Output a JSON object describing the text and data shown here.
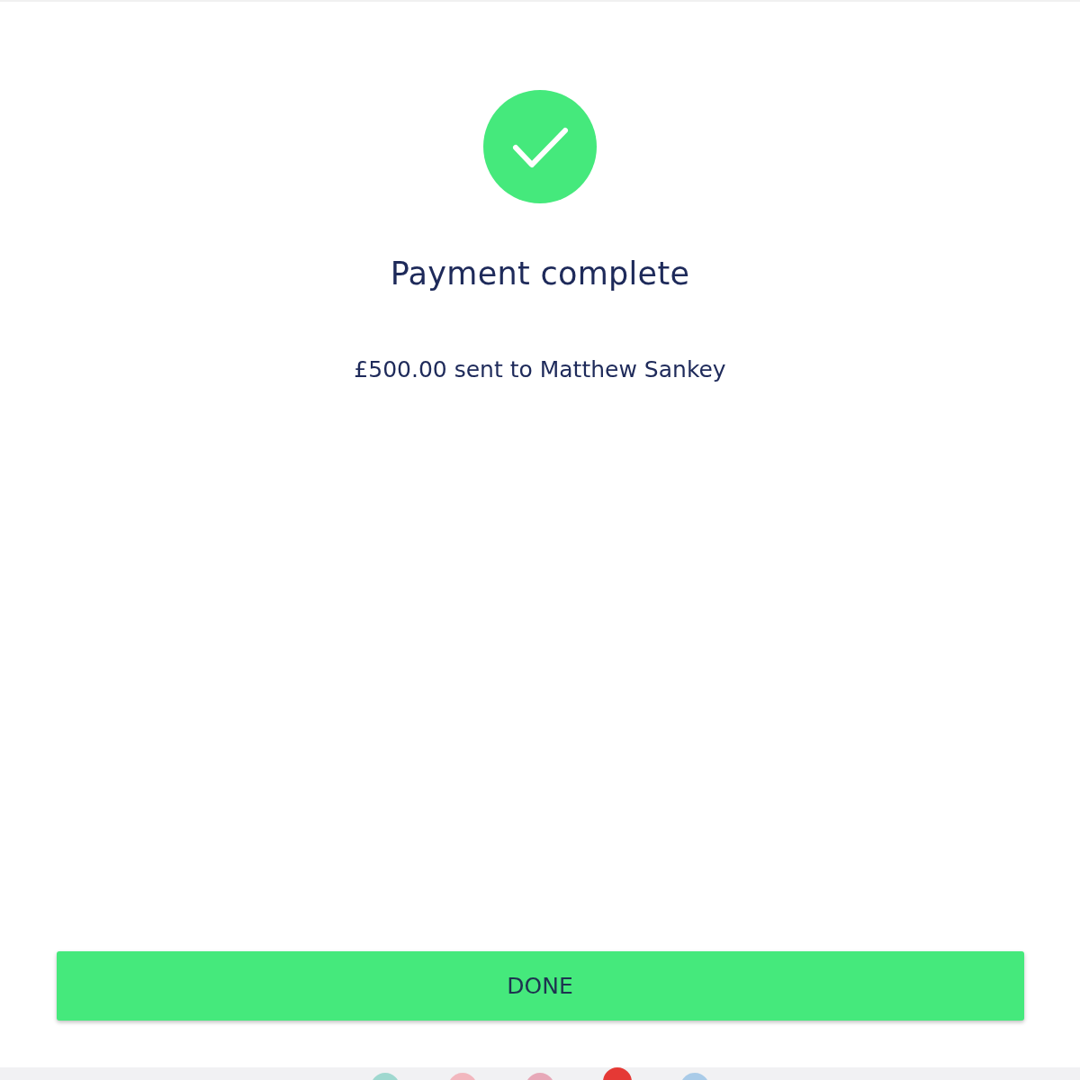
{
  "status": {
    "title": "Payment complete",
    "message": "£500.00 sent to Matthew Sankey"
  },
  "button": {
    "label": "DONE"
  }
}
